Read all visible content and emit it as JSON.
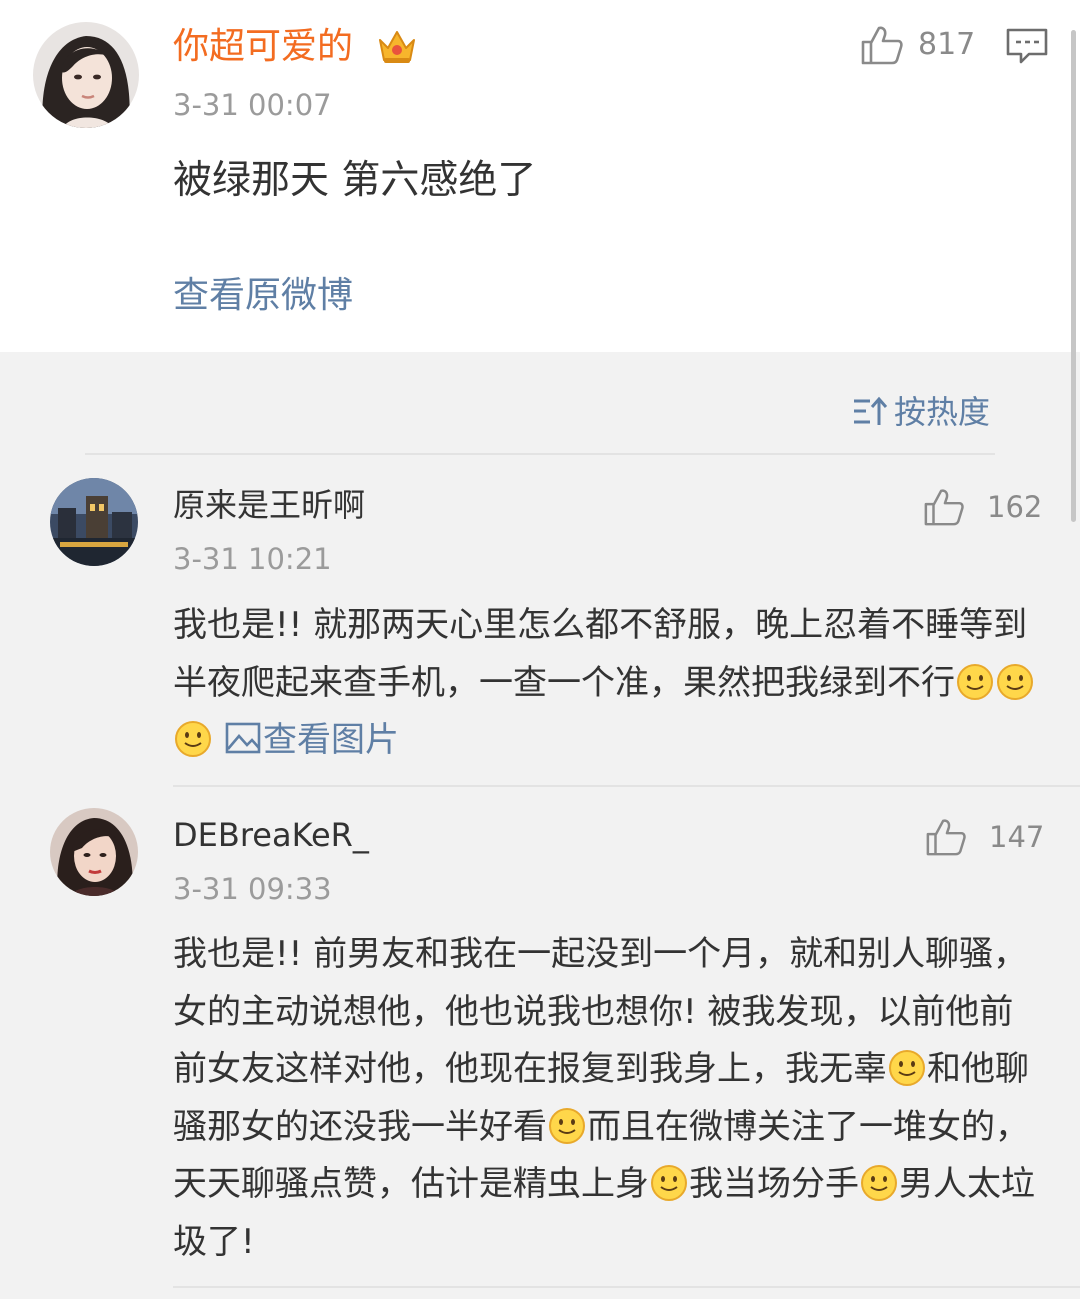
{
  "post": {
    "author": "你超可爱的",
    "time": "3-31 00:07",
    "text": "被绿那天 第六感绝了",
    "likes": "817",
    "view_original": "查看原微博"
  },
  "sort": {
    "label": "按热度"
  },
  "comments": [
    {
      "author": "原来是王昕啊",
      "time": "3-31 10:21",
      "likes": "162",
      "segments": [
        "我也是!! 就那两天心里怎么都不舒服，晚上忍着不睡等到半夜爬起来查手机，一查一个准，果然把我绿到不行"
      ],
      "view_image": "查看图片"
    },
    {
      "author": "DEBreaKeR_",
      "time": "3-31 09:33",
      "likes": "147",
      "segments": [
        "我也是!! 前男友和我在一起没到一个月，就和别人聊骚，女的主动说想他，他也说我也想你! 被我发现，以前他前前女友这样对他，他现在报复到我身上，我无辜",
        "和他聊骚那女的还没我一半好看",
        "而且在微博关注了一堆女的，天天聊骚点赞，估计是精虫上身",
        "我当场分手",
        "男人太垃圾了!"
      ]
    }
  ],
  "icons": {
    "like": "thumbs-up-icon",
    "comment": "comment-bubble-icon",
    "sort": "sort-icon",
    "crown": "crown-badge-icon",
    "emoji": "smile-emoji-icon",
    "image": "image-icon"
  },
  "colors": {
    "username_orange": "#f36c21",
    "link_blue": "#5f7fa5",
    "text": "#333333",
    "muted": "#9b9b9b",
    "background": "#f2f2f2"
  }
}
